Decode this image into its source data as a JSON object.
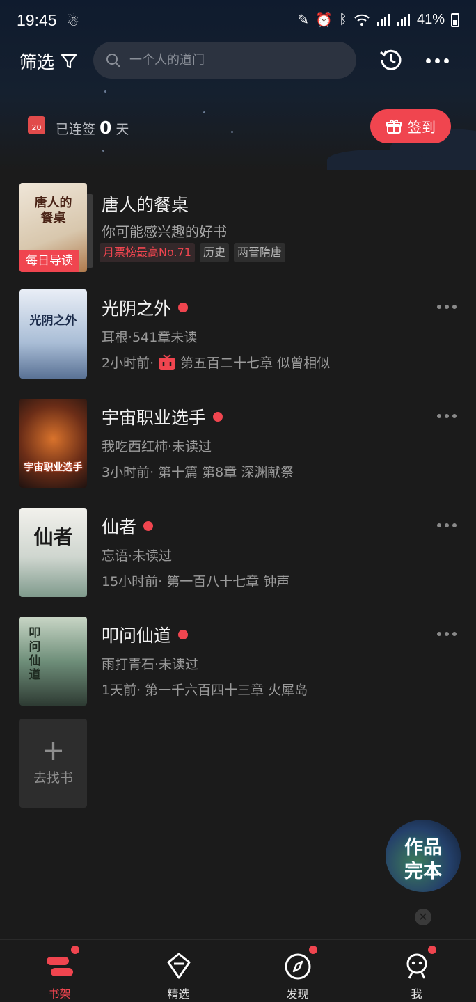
{
  "status_bar": {
    "time": "19:45",
    "battery": "41%"
  },
  "header": {
    "filter_label": "筛选",
    "search_placeholder": "一个人的道门"
  },
  "sign": {
    "prefix": "已连签",
    "days": "0",
    "suffix": "天",
    "calendar_day": "20",
    "button_label": "签到"
  },
  "featured": {
    "title": "唐人的餐桌",
    "subtitle": "你可能感兴趣的好书",
    "badge": "每日导读",
    "cover_text": "唐人的餐桌",
    "tags": [
      {
        "label": "月票榜最高No.71",
        "highlight": true
      },
      {
        "label": "历史",
        "highlight": false
      },
      {
        "label": "两晋隋唐",
        "highlight": false
      }
    ]
  },
  "books": [
    {
      "title": "光阴之外",
      "author_status": "耳根·541章未读",
      "time": "2小时前·",
      "chapter": "第五百二十七章 似曾相似",
      "has_tv_icon": true,
      "cover_text": "光阴之外"
    },
    {
      "title": "宇宙职业选手",
      "author_status": "我吃西红柿·未读过",
      "time": "3小时前·",
      "chapter": "第十篇 第8章 深渊献祭",
      "has_tv_icon": false,
      "cover_text": "宇宙职业选手"
    },
    {
      "title": "仙者",
      "author_status": "忘语·未读过",
      "time": "15小时前·",
      "chapter": "第一百八十七章 钟声",
      "has_tv_icon": false,
      "cover_text": "仙者"
    },
    {
      "title": "叩问仙道",
      "author_status": "雨打青石·未读过",
      "time": "1天前·",
      "chapter": "第一千六百四十三章 火犀岛",
      "has_tv_icon": false,
      "cover_text": "叩问仙道"
    }
  ],
  "add_book_label": "去找书",
  "float_badge": {
    "line1": "作品",
    "line2": "完本"
  },
  "tabs": [
    {
      "label": "书架",
      "active": true,
      "has_dot": true
    },
    {
      "label": "精选",
      "active": false,
      "has_dot": false
    },
    {
      "label": "发现",
      "active": false,
      "has_dot": true
    },
    {
      "label": "我",
      "active": false,
      "has_dot": true
    }
  ],
  "colors": {
    "accent": "#f0454f",
    "background": "#1b1b1b",
    "header_bg": "#0f1b2e"
  }
}
